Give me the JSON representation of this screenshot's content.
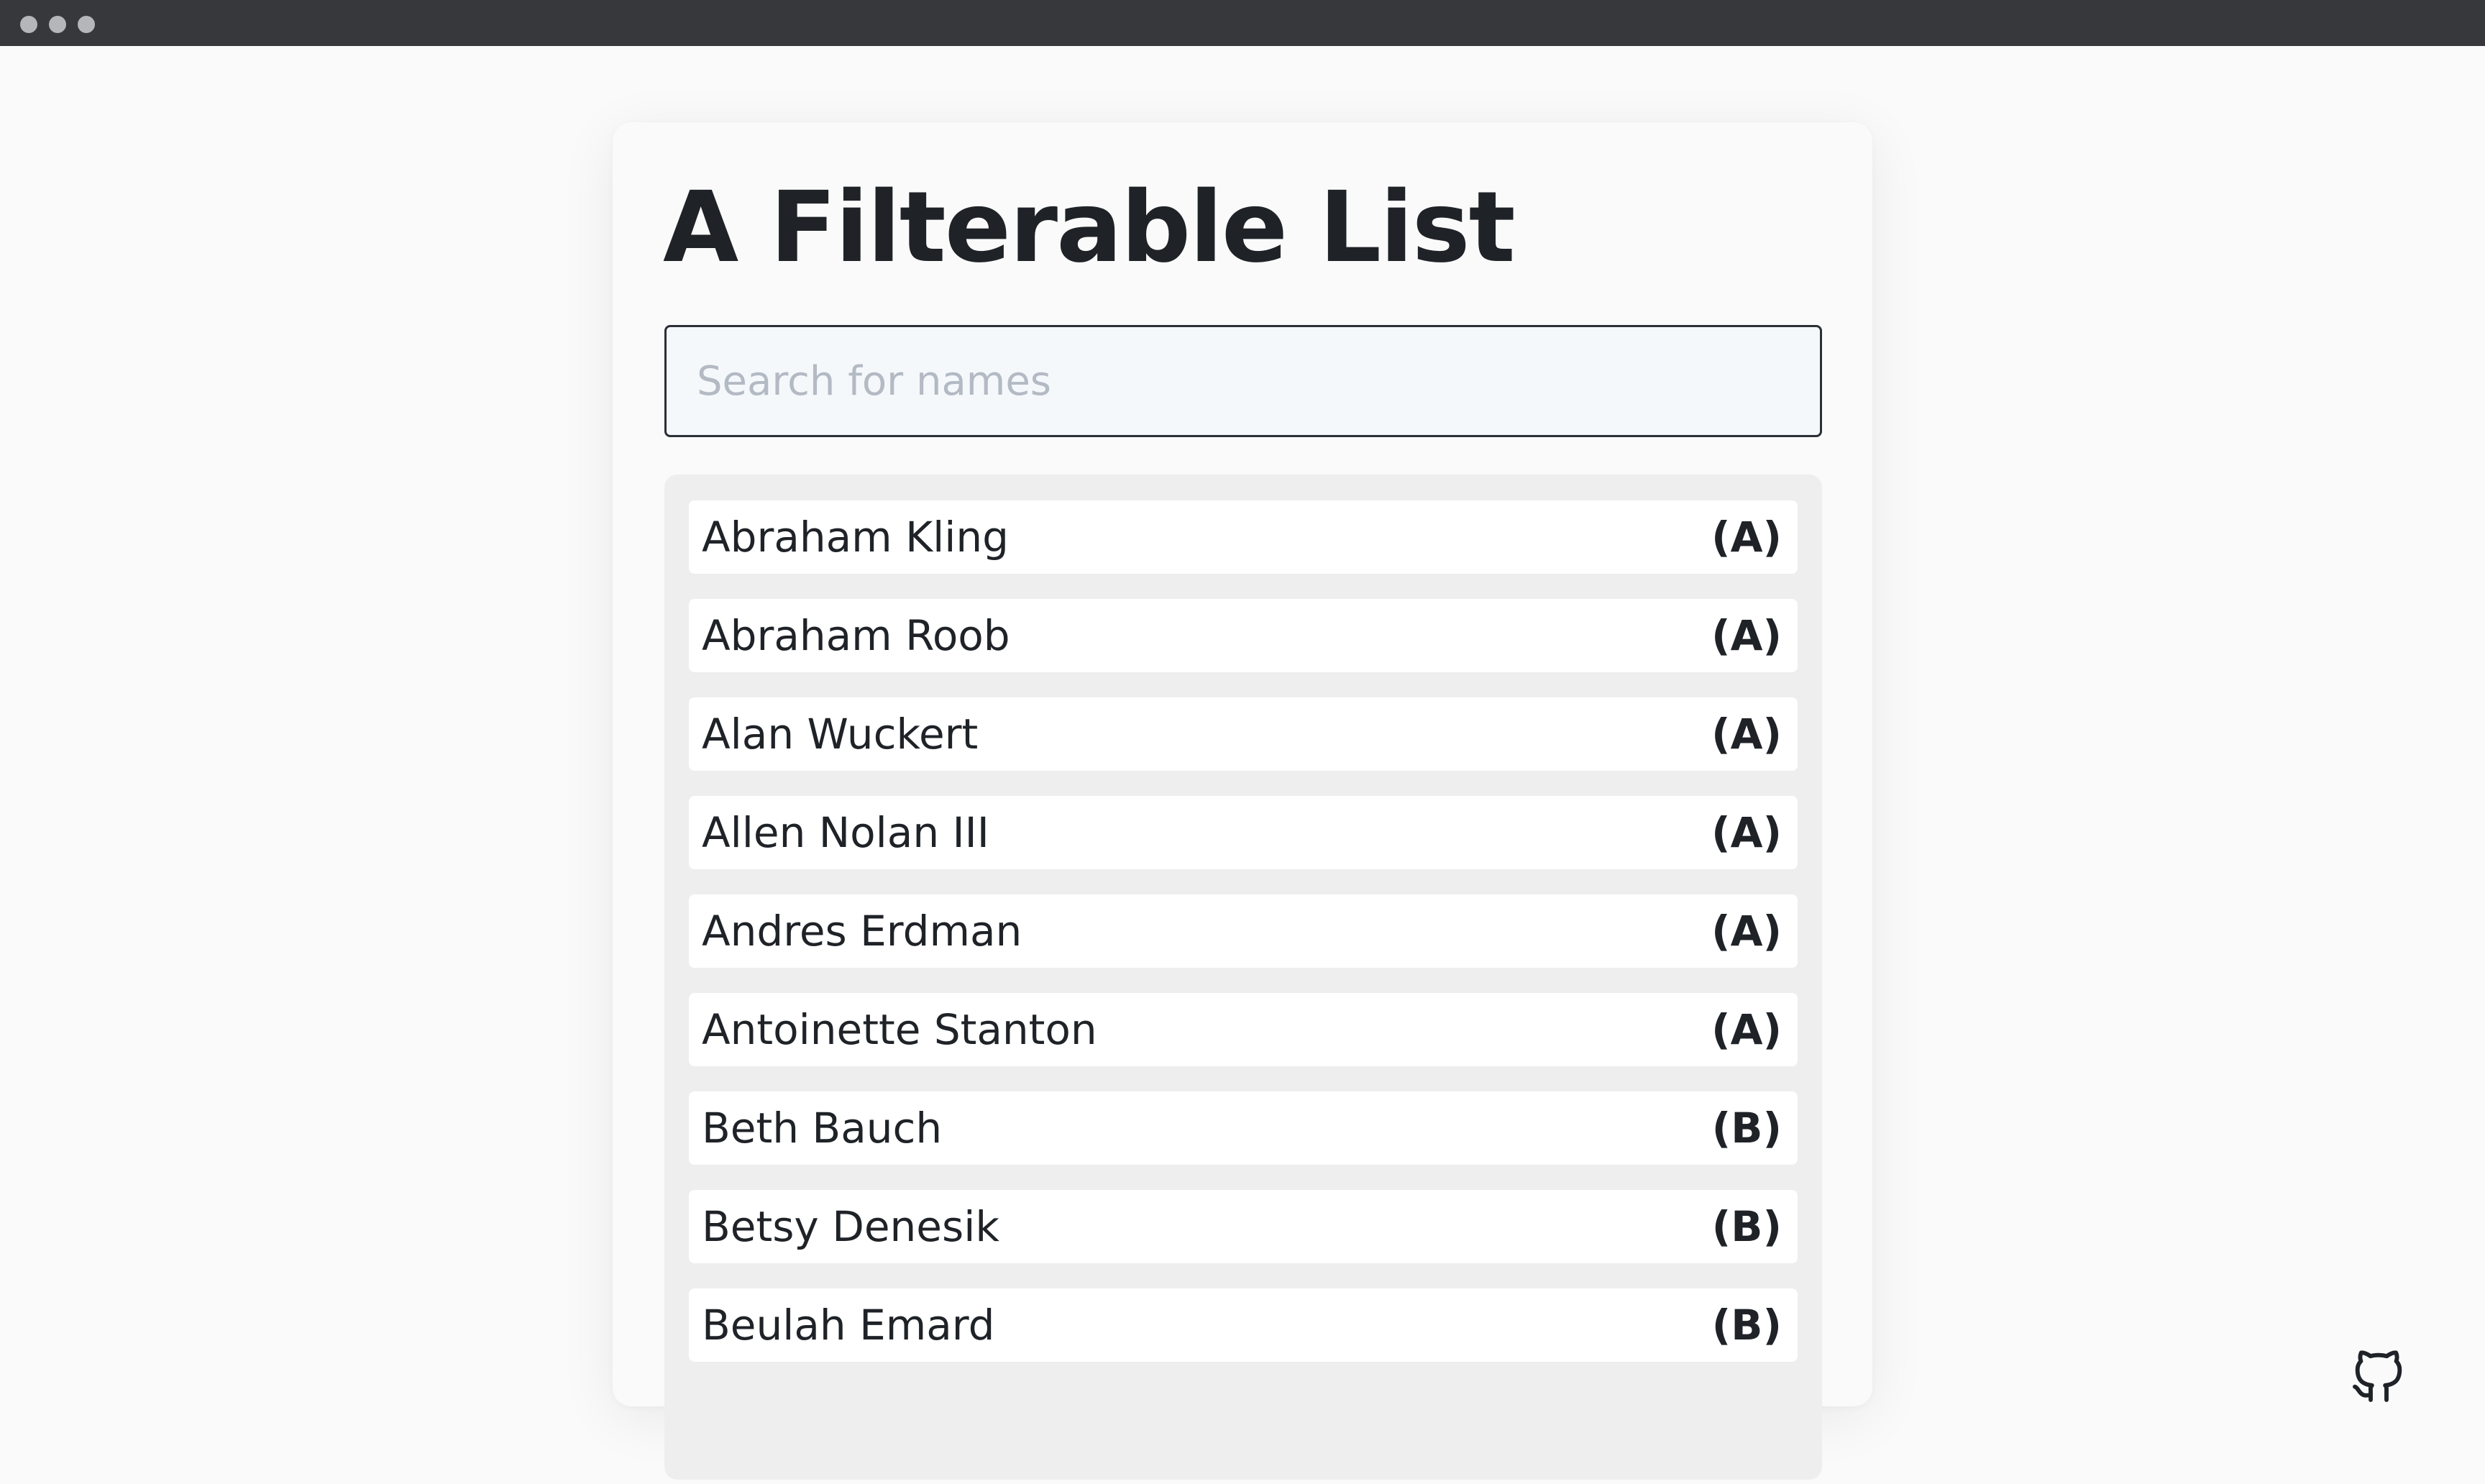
{
  "title": "A Filterable List",
  "search": {
    "placeholder": "Search for names",
    "value": ""
  },
  "items": [
    {
      "name": "Abraham Kling",
      "letter": "(A)"
    },
    {
      "name": "Abraham Roob",
      "letter": "(A)"
    },
    {
      "name": "Alan Wuckert",
      "letter": "(A)"
    },
    {
      "name": "Allen Nolan III",
      "letter": "(A)"
    },
    {
      "name": "Andres Erdman",
      "letter": "(A)"
    },
    {
      "name": "Antoinette Stanton",
      "letter": "(A)"
    },
    {
      "name": "Beth Bauch",
      "letter": "(B)"
    },
    {
      "name": "Betsy Denesik",
      "letter": "(B)"
    },
    {
      "name": "Beulah Emard",
      "letter": "(B)"
    }
  ],
  "icons": {
    "github": "github-icon",
    "window_controls": "window-dots-icon"
  },
  "colors": {
    "background": "#fafafa",
    "window_bar": "#37383b",
    "text": "#1f2328",
    "list_background": "#eeeeee",
    "item_background": "#ffffff",
    "placeholder": "#b3bac4"
  }
}
